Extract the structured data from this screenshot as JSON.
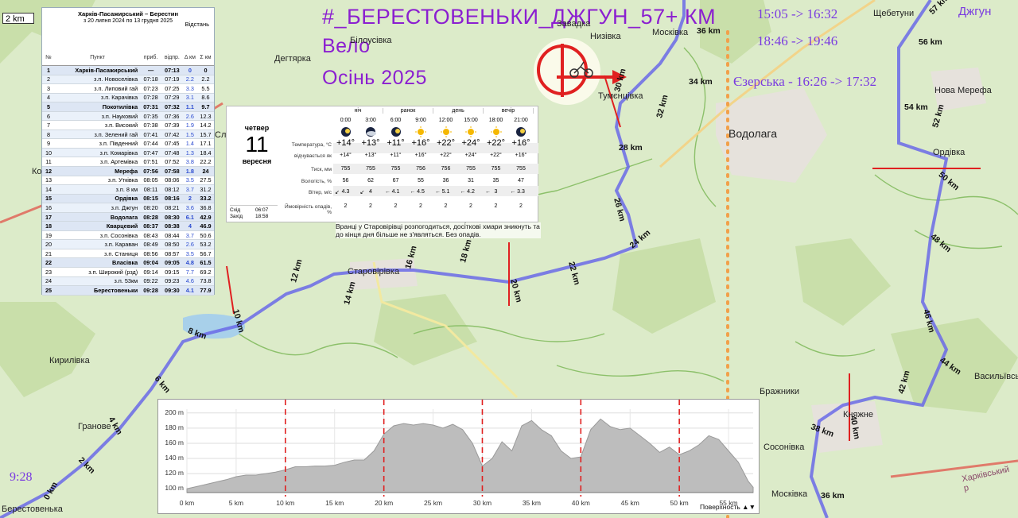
{
  "scale_label": "2 km",
  "title": {
    "line1": "#_БЕРЕСТОВЕНЬКИ_ДЖГУН_57+ КМ",
    "line2": "Вело",
    "line3": "Осінь 2025"
  },
  "times": {
    "t1": "15:05 -> 16:32",
    "t2": "18:46 -> 19:46",
    "ezerska": "Єзерська - 16:26 -> 17:32",
    "start": "9:28"
  },
  "places": {
    "shchebetun": "Щебетуни",
    "dzhhun": "Джгун",
    "moskivka_top": "Москівка",
    "nyzivka": "Низівка",
    "zavadka": "Завадка",
    "bilousivka": "Білоусівка",
    "dehtiarka": "Дегтярка",
    "tumentsiivka": "Тумєнцівка",
    "vodolaha": "Водолага",
    "nova_merefa": "Нова Мерефа",
    "ordivka": "Ордівка",
    "starovirivka": "Старовірівка",
    "kyrylivka": "Кирилівка",
    "hranove": "Гранове",
    "berestovenka": "Берестовенька",
    "vasylivske": "Васильївське",
    "brazhnyky": "Бражники",
    "kniazhne": "Княжне",
    "sosonivka": "Сосонівка",
    "moskivka_bottom": "Москівка",
    "kharkiv_road": "Харківський р",
    "ko": "Ко",
    "slo": "Сло"
  },
  "km_marks": [
    "0 km",
    "2 km",
    "4 km",
    "6 km",
    "8 km",
    "10 km",
    "12 km",
    "14 km",
    "16 km",
    "18 km",
    "20 km",
    "22 km",
    "24 km",
    "26 km",
    "28 km",
    "30 km",
    "32 km",
    "34 km",
    "36 km",
    "38 km",
    "40 km",
    "42 km",
    "44 km",
    "46 km",
    "48 km",
    "50 km",
    "52 km",
    "54 km",
    "56 km",
    "57 km",
    "36 km"
  ],
  "train": {
    "route": "Харків-Пасажирський – Берестин",
    "range": "з 20 липня 2024 по 13 грудня 2025",
    "dist_header": "Відстань",
    "headers": {
      "num": "№",
      "point": "Пункт",
      "arr": "приб.",
      "dep": "відпр.",
      "delta": "Δ км",
      "sum": "Σ км"
    },
    "rows": [
      {
        "n": "1",
        "p": "Харків-Пасажирський",
        "a": "—",
        "d": "07:13",
        "dl": "0",
        "s": "0",
        "bold": true
      },
      {
        "n": "2",
        "p": "з.п. Новоселівка",
        "a": "07:18",
        "d": "07:19",
        "dl": "2.2",
        "s": "2.2"
      },
      {
        "n": "3",
        "p": "з.п. Липовий гай",
        "a": "07:23",
        "d": "07:25",
        "dl": "3.3",
        "s": "5.5"
      },
      {
        "n": "4",
        "p": "з.п. Карачівка",
        "a": "07:28",
        "d": "07:29",
        "dl": "3.1",
        "s": "8.6"
      },
      {
        "n": "5",
        "p": "Покотилівка",
        "a": "07:31",
        "d": "07:32",
        "dl": "1.1",
        "s": "9.7",
        "bold": true
      },
      {
        "n": "6",
        "p": "з.п. Науковий",
        "a": "07:35",
        "d": "07:36",
        "dl": "2.6",
        "s": "12.3"
      },
      {
        "n": "7",
        "p": "з.п. Високий",
        "a": "07:38",
        "d": "07:39",
        "dl": "1.9",
        "s": "14.2"
      },
      {
        "n": "8",
        "p": "з.п. Зелений гай",
        "a": "07:41",
        "d": "07:42",
        "dl": "1.5",
        "s": "15.7"
      },
      {
        "n": "9",
        "p": "з.п. Південний",
        "a": "07:44",
        "d": "07:45",
        "dl": "1.4",
        "s": "17.1"
      },
      {
        "n": "10",
        "p": "з.п. Комарівка",
        "a": "07:47",
        "d": "07:48",
        "dl": "1.3",
        "s": "18.4"
      },
      {
        "n": "11",
        "p": "з.п. Артемівка",
        "a": "07:51",
        "d": "07:52",
        "dl": "3.8",
        "s": "22.2"
      },
      {
        "n": "12",
        "p": "Мерефа",
        "a": "07:56",
        "d": "07:58",
        "dl": "1.8",
        "s": "24",
        "bold": true
      },
      {
        "n": "13",
        "p": "з.п. Утківка",
        "a": "08:05",
        "d": "08:06",
        "dl": "3.5",
        "s": "27.5"
      },
      {
        "n": "14",
        "p": "з.п. 8 км",
        "a": "08:11",
        "d": "08:12",
        "dl": "3.7",
        "s": "31.2"
      },
      {
        "n": "15",
        "p": "Ордівка",
        "a": "08:15",
        "d": "08:16",
        "dl": "2",
        "s": "33.2",
        "bold": true
      },
      {
        "n": "16",
        "p": "з.п. Джгун",
        "a": "08:20",
        "d": "08:21",
        "dl": "3.6",
        "s": "36.8"
      },
      {
        "n": "17",
        "p": "Водолага",
        "a": "08:28",
        "d": "08:30",
        "dl": "6.1",
        "s": "42.9",
        "bold": true
      },
      {
        "n": "18",
        "p": "Кварцевий",
        "a": "08:37",
        "d": "08:38",
        "dl": "4",
        "s": "46.9",
        "bold": true
      },
      {
        "n": "19",
        "p": "з.п. Сосонівка",
        "a": "08:43",
        "d": "08:44",
        "dl": "3.7",
        "s": "50.6"
      },
      {
        "n": "20",
        "p": "з.п. Караван",
        "a": "08:49",
        "d": "08:50",
        "dl": "2.6",
        "s": "53.2"
      },
      {
        "n": "21",
        "p": "з.п. Станиця",
        "a": "08:56",
        "d": "08:57",
        "dl": "3.5",
        "s": "56.7"
      },
      {
        "n": "22",
        "p": "Власівка",
        "a": "09:04",
        "d": "09:05",
        "dl": "4.8",
        "s": "61.5",
        "bold": true
      },
      {
        "n": "23",
        "p": "з.п. Широкий (рзд)",
        "a": "09:14",
        "d": "09:15",
        "dl": "7.7",
        "s": "69.2"
      },
      {
        "n": "24",
        "p": "з.п. 53км",
        "a": "09:22",
        "d": "09:23",
        "dl": "4.6",
        "s": "73.8"
      },
      {
        "n": "25",
        "p": "Берестовеньки",
        "a": "09:28",
        "d": "09:30",
        "dl": "4.1",
        "s": "77.9",
        "bold": true
      }
    ]
  },
  "weather": {
    "weekday": "четвер",
    "day": "11",
    "month": "вересня",
    "sunrise_label": "Схід",
    "sunrise": "06:07",
    "sunset_label": "Захід",
    "sunset": "18:58",
    "periods": [
      "ніч",
      "ранок",
      "день",
      "вечір"
    ],
    "times": [
      "0:00",
      "3:00",
      "6:00",
      "9:00",
      "12:00",
      "15:00",
      "18:00",
      "21:00"
    ],
    "icons": [
      "moon-icon",
      "cloud-moon-icon",
      "moon-icon",
      "sun-icon",
      "sun-icon",
      "sun-icon",
      "sun-icon",
      "moon-icon"
    ],
    "labels": {
      "temp": "Температура, °C",
      "feels": "відчувається як",
      "pressure": "Тиск, мм",
      "humidity": "Вологість, %",
      "wind": "Вітер, м/с",
      "precip": "Ймовірність опадів, %"
    },
    "temp": [
      "+14°",
      "+13°",
      "+11°",
      "+16°",
      "+22°",
      "+24°",
      "+22°",
      "+16°"
    ],
    "feels": [
      "+14°",
      "+13°",
      "+11°",
      "+16°",
      "+22°",
      "+24°",
      "+22°",
      "+16°"
    ],
    "pressure": [
      "755",
      "755",
      "755",
      "756",
      "756",
      "755",
      "755",
      "755"
    ],
    "humidity": [
      "56",
      "62",
      "67",
      "55",
      "36",
      "31",
      "35",
      "47"
    ],
    "wind": [
      "4.3",
      "4",
      "4.1",
      "4.5",
      "5.1",
      "4.2",
      "3",
      "3.3"
    ],
    "precip": [
      "2",
      "2",
      "2",
      "2",
      "2",
      "2",
      "2",
      "2"
    ],
    "forecast": "Вранці у Старовірівці розпогодиться, досі́ткові хмари зникнуть та до кінця дня більше не з'являться. Без опадів."
  },
  "elevation": {
    "y_ticks": [
      "200 m",
      "180 m",
      "160 m",
      "140 m",
      "120 m",
      "100 m"
    ],
    "x_ticks": [
      "0 km",
      "5 km",
      "10 km",
      "15 km",
      "20 km",
      "25 km",
      "30 km",
      "35 km",
      "40 km",
      "45 km",
      "50 km",
      "55 km"
    ],
    "surface_label": "Поверхность",
    "chart_data": {
      "type": "area",
      "xlabel": "",
      "ylabel": "",
      "ylim": [
        95,
        205
      ],
      "xlim": [
        0,
        57.5
      ],
      "x": [
        0,
        1,
        2,
        3,
        4,
        5,
        6,
        7,
        8,
        9,
        10,
        11,
        12,
        13,
        14,
        15,
        16,
        17,
        18,
        19,
        20,
        21,
        22,
        23,
        24,
        25,
        26,
        27,
        28,
        29,
        30,
        31,
        32,
        33,
        34,
        35,
        36,
        37,
        38,
        39,
        40,
        41,
        42,
        43,
        44,
        45,
        46,
        47,
        48,
        49,
        50,
        51,
        52,
        53,
        54,
        55,
        56,
        57,
        57.5
      ],
      "y": [
        100,
        103,
        106,
        109,
        112,
        116,
        118,
        118,
        120,
        122,
        125,
        129,
        129,
        130,
        130,
        131,
        135,
        138,
        138,
        150,
        172,
        183,
        186,
        184,
        186,
        184,
        180,
        185,
        178,
        160,
        130,
        140,
        162,
        150,
        183,
        190,
        178,
        170,
        150,
        140,
        142,
        178,
        192,
        182,
        178,
        180,
        170,
        160,
        148,
        155,
        145,
        150,
        158,
        170,
        165,
        150,
        135,
        110,
        102
      ],
      "markers_km": [
        10,
        20,
        30,
        40,
        50
      ]
    }
  }
}
